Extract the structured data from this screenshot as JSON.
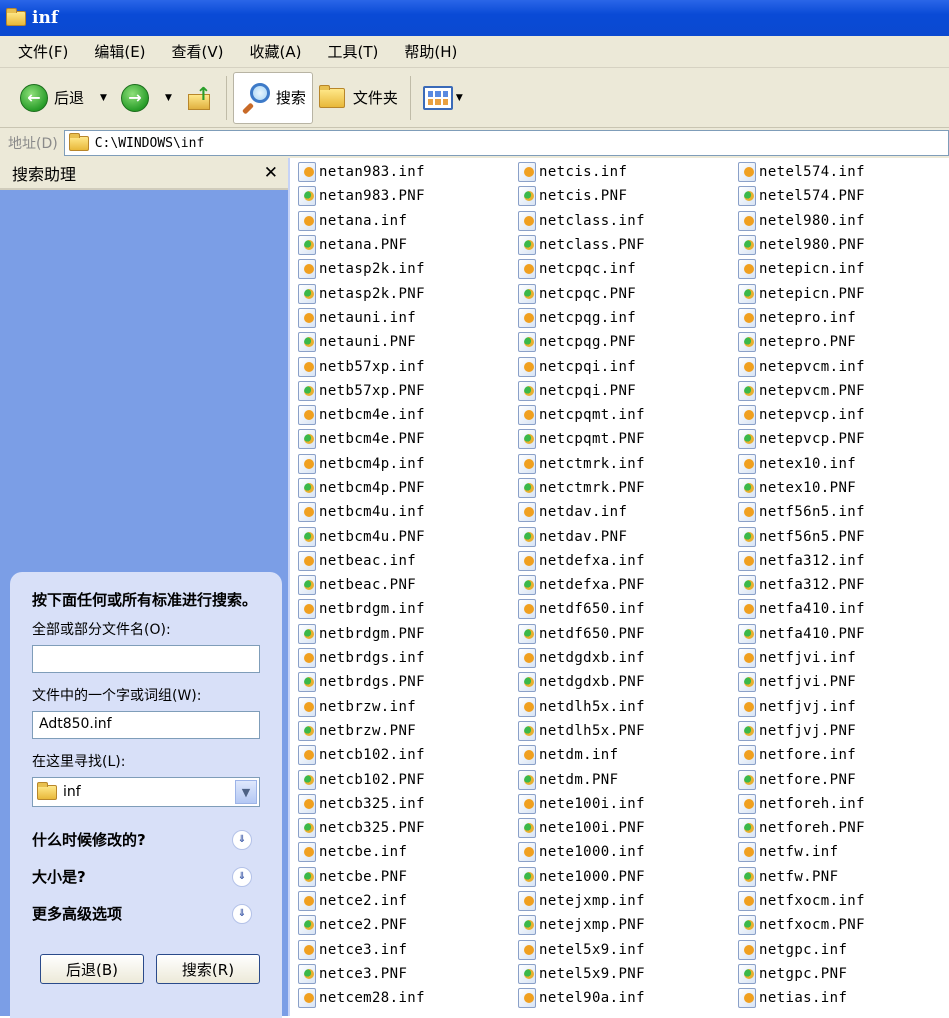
{
  "window": {
    "title": "inf"
  },
  "menu": [
    "文件(F)",
    "编辑(E)",
    "查看(V)",
    "收藏(A)",
    "工具(T)",
    "帮助(H)"
  ],
  "toolbar": {
    "back_label": "后退",
    "search_label": "搜索",
    "folders_label": "文件夹"
  },
  "address": {
    "label": "地址(D)",
    "path": "C:\\WINDOWS\\inf"
  },
  "sidebar": {
    "title": "搜索助理",
    "intro": "按下面任何或所有标准进行搜索。",
    "filename_label": "全部或部分文件名(O):",
    "filename_value": "",
    "phrase_label": "文件中的一个字或词组(W):",
    "phrase_value": "Adt850.inf",
    "lookin_label": "在这里寻找(L):",
    "lookin_value": "inf",
    "options": [
      "什么时候修改的?",
      "大小是?",
      "更多高级选项"
    ],
    "back_button": "后退(B)",
    "search_button": "搜索(R)"
  },
  "files": {
    "col1": [
      "netan983.inf",
      "netan983.PNF",
      "netana.inf",
      "netana.PNF",
      "netasp2k.inf",
      "netasp2k.PNF",
      "netauni.inf",
      "netauni.PNF",
      "netb57xp.inf",
      "netb57xp.PNF",
      "netbcm4e.inf",
      "netbcm4e.PNF",
      "netbcm4p.inf",
      "netbcm4p.PNF",
      "netbcm4u.inf",
      "netbcm4u.PNF",
      "netbeac.inf",
      "netbeac.PNF",
      "netbrdgm.inf",
      "netbrdgm.PNF",
      "netbrdgs.inf",
      "netbrdgs.PNF",
      "netbrzw.inf",
      "netbrzw.PNF",
      "netcb102.inf",
      "netcb102.PNF",
      "netcb325.inf",
      "netcb325.PNF",
      "netcbe.inf",
      "netcbe.PNF",
      "netce2.inf",
      "netce2.PNF",
      "netce3.inf",
      "netce3.PNF",
      "netcem28.inf"
    ],
    "col2": [
      "netcis.inf",
      "netcis.PNF",
      "netclass.inf",
      "netclass.PNF",
      "netcpqc.inf",
      "netcpqc.PNF",
      "netcpqg.inf",
      "netcpqg.PNF",
      "netcpqi.inf",
      "netcpqi.PNF",
      "netcpqmt.inf",
      "netcpqmt.PNF",
      "netctmrk.inf",
      "netctmrk.PNF",
      "netdav.inf",
      "netdav.PNF",
      "netdefxa.inf",
      "netdefxa.PNF",
      "netdf650.inf",
      "netdf650.PNF",
      "netdgdxb.inf",
      "netdgdxb.PNF",
      "netdlh5x.inf",
      "netdlh5x.PNF",
      "netdm.inf",
      "netdm.PNF",
      "nete100i.inf",
      "nete100i.PNF",
      "nete1000.inf",
      "nete1000.PNF",
      "netejxmp.inf",
      "netejxmp.PNF",
      "netel5x9.inf",
      "netel5x9.PNF",
      "netel90a.inf"
    ],
    "col3": [
      "netel574.inf",
      "netel574.PNF",
      "netel980.inf",
      "netel980.PNF",
      "netepicn.inf",
      "netepicn.PNF",
      "netepro.inf",
      "netepro.PNF",
      "netepvcm.inf",
      "netepvcm.PNF",
      "netepvcp.inf",
      "netepvcp.PNF",
      "netex10.inf",
      "netex10.PNF",
      "netf56n5.inf",
      "netf56n5.PNF",
      "netfa312.inf",
      "netfa312.PNF",
      "netfa410.inf",
      "netfa410.PNF",
      "netfjvi.inf",
      "netfjvi.PNF",
      "netfjvj.inf",
      "netfjvj.PNF",
      "netfore.inf",
      "netfore.PNF",
      "netforeh.inf",
      "netforeh.PNF",
      "netfw.inf",
      "netfw.PNF",
      "netfxocm.inf",
      "netfxocm.PNF",
      "netgpc.inf",
      "netgpc.PNF",
      "netias.inf"
    ]
  }
}
